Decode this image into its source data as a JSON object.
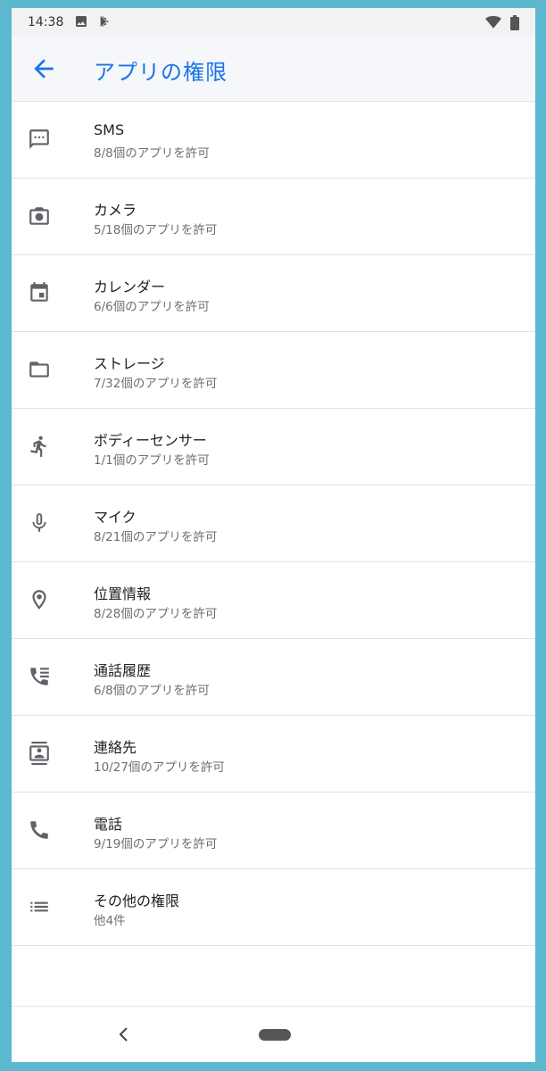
{
  "status_bar": {
    "time": "14:38",
    "icons": [
      "image-icon",
      "play-store-icon",
      "wifi-icon",
      "battery-icon"
    ]
  },
  "app_bar": {
    "back_icon": "arrow-back-icon",
    "title": "アプリの権限",
    "accent_color": "#1a73e8"
  },
  "permissions": [
    {
      "icon": "sms-icon",
      "label": "SMS",
      "detail": "8/8個のアプリを許可"
    },
    {
      "icon": "camera-icon",
      "label": "カメラ",
      "detail": "5/18個のアプリを許可"
    },
    {
      "icon": "calendar-icon",
      "label": "カレンダー",
      "detail": "6/6個のアプリを許可"
    },
    {
      "icon": "folder-icon",
      "label": "ストレージ",
      "detail": "7/32個のアプリを許可"
    },
    {
      "icon": "body-sensor-icon",
      "label": "ボディーセンサー",
      "detail": "1/1個のアプリを許可"
    },
    {
      "icon": "microphone-icon",
      "label": "マイク",
      "detail": "8/21個のアプリを許可"
    },
    {
      "icon": "location-icon",
      "label": "位置情報",
      "detail": "8/28個のアプリを許可"
    },
    {
      "icon": "call-log-icon",
      "label": "通話履歴",
      "detail": "6/8個のアプリを許可"
    },
    {
      "icon": "contacts-icon",
      "label": "連絡先",
      "detail": "10/27個のアプリを許可"
    },
    {
      "icon": "phone-icon",
      "label": "電話",
      "detail": "9/19個のアプリを許可"
    },
    {
      "icon": "list-icon",
      "label": "その他の権限",
      "detail": "他4件"
    }
  ],
  "nav_bar": {
    "back_icon": "nav-back-icon",
    "home_icon": "home-pill-icon"
  }
}
